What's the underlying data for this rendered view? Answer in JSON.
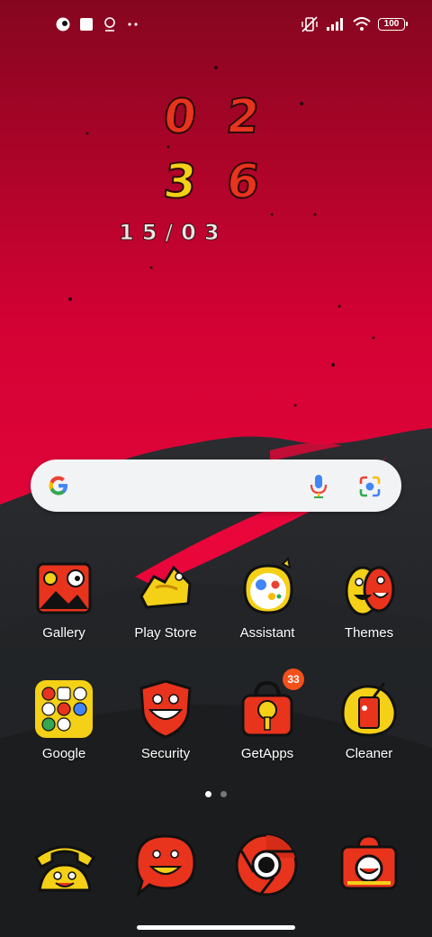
{
  "status_bar": {
    "right_icons": [
      "vibrate-off-icon",
      "signal-icon",
      "wifi-icon"
    ],
    "battery": "100",
    "left_icons": [
      "app-notification-icon",
      "square-icon",
      "location-icon",
      "more-dots-icon"
    ]
  },
  "clock": {
    "hour_1": "0",
    "hour_2": "2",
    "minute_1": "3",
    "minute_2": "6",
    "date": "15/03"
  },
  "colors": {
    "wall_top": "#86061f",
    "wall_mid": "#e8063a",
    "dark": "#1f2124",
    "digit_red": "#e8331d",
    "digit_yellow": "#f4d017"
  },
  "search": {
    "google_icon": "google-g-icon",
    "mic_icon": "mic-icon",
    "lens_icon": "lens-icon"
  },
  "apps": [
    {
      "label": "Gallery",
      "icon": "gallery-icon"
    },
    {
      "label": "Play Store",
      "icon": "play-store-icon"
    },
    {
      "label": "Assistant",
      "icon": "assistant-icon"
    },
    {
      "label": "Themes",
      "icon": "themes-icon"
    },
    {
      "label": "Google",
      "icon": "google-folder-icon"
    },
    {
      "label": "Security",
      "icon": "security-icon"
    },
    {
      "label": "GetApps",
      "icon": "getapps-icon",
      "badge": "33"
    },
    {
      "label": "Cleaner",
      "icon": "cleaner-icon"
    }
  ],
  "page_indicator": {
    "count": 2,
    "active": 1
  },
  "dock": [
    {
      "icon": "phone-icon"
    },
    {
      "icon": "messages-icon"
    },
    {
      "icon": "chrome-icon"
    },
    {
      "icon": "camera-icon"
    }
  ]
}
